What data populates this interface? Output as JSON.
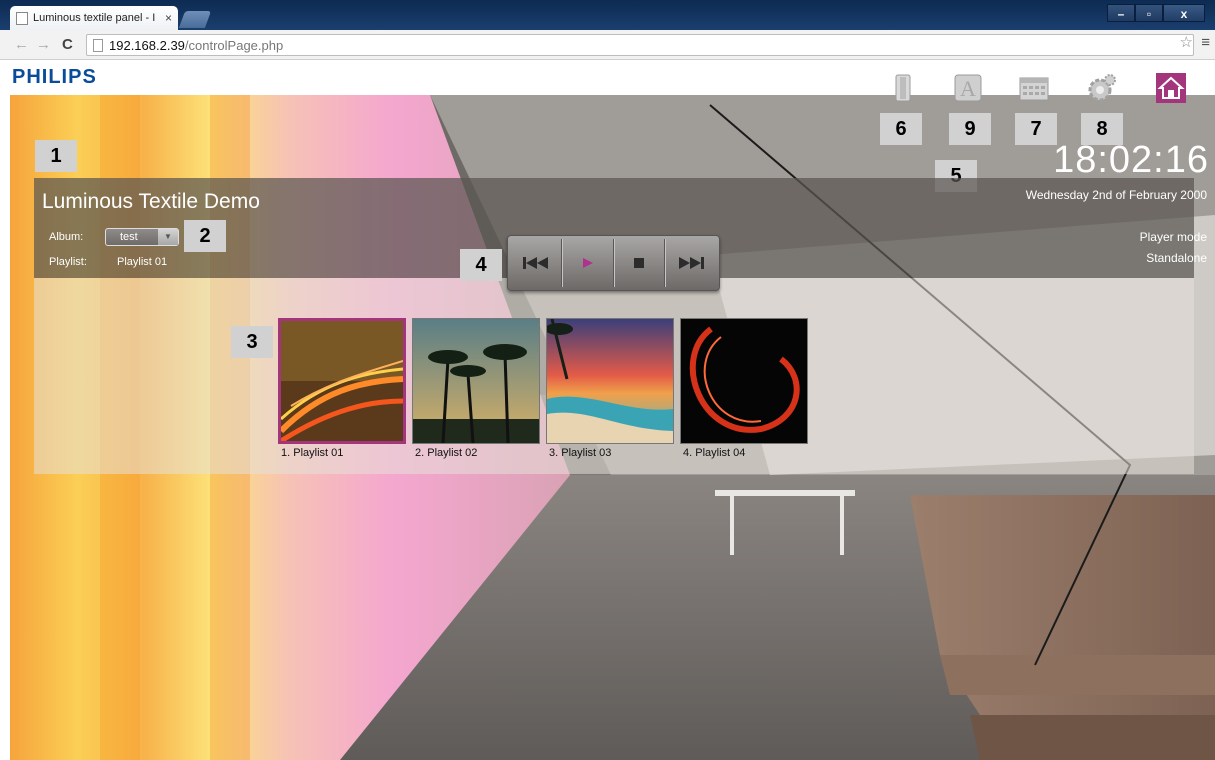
{
  "browser": {
    "tab_title": "Luminous textile panel - I",
    "tab_close": "×",
    "url_host": "192.168.2.39",
    "url_path": "/controlPage.php",
    "window_controls": [
      "–",
      "▫",
      "x"
    ]
  },
  "header": {
    "logo": "PHILIPS",
    "tool_icons": [
      "library-icon",
      "text-icon",
      "calendar-icon",
      "settings-icon",
      "home-icon"
    ]
  },
  "callouts": {
    "n1": "1",
    "n2": "2",
    "n3": "3",
    "n4": "4",
    "n5": "5",
    "n6": "6",
    "n7": "7",
    "n8": "8",
    "n9": "9"
  },
  "info": {
    "title": "Luminous Textile Demo",
    "album_label": "Album:",
    "album_value": "test",
    "playlist_label": "Playlist:",
    "playlist_value": "Playlist 01",
    "clock": "18:02:16",
    "date": "Wednesday 2nd of February 2000",
    "mode_label": "Player mode",
    "mode_value": "Standalone"
  },
  "transport": {
    "buttons": [
      "previous-icon",
      "play-icon",
      "stop-icon",
      "next-icon"
    ],
    "play_color": "#b0328f"
  },
  "playlists": [
    {
      "caption": "1. Playlist 01",
      "selected": true
    },
    {
      "caption": "2. Playlist 02",
      "selected": false
    },
    {
      "caption": "3. Playlist 03",
      "selected": false
    },
    {
      "caption": "4. Playlist 04",
      "selected": false
    }
  ],
  "colors": {
    "accent": "#a3357d",
    "brand": "#0b4c9a"
  }
}
